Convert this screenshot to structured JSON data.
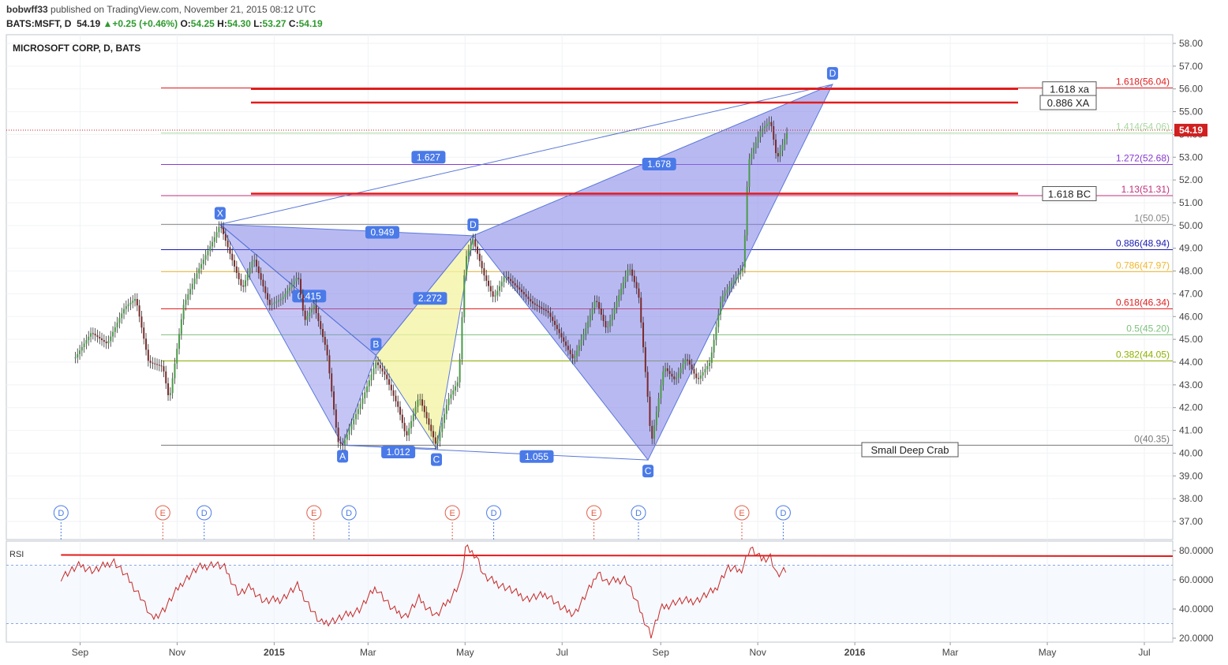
{
  "header": {
    "author": "bobwff33",
    "published": "published on TradingView.com, November 21, 2015 08:12 UTC",
    "symbol": "BATS:MSFT, D",
    "last": "54.19",
    "change": "+0.25 (+0.46%)",
    "open_label": "O:",
    "open": "54.25",
    "high_label": "H:",
    "high": "54.30",
    "low_label": "L:",
    "low": "53.27",
    "close_label": "C:",
    "close": "54.19"
  },
  "chart_data": {
    "type": "candlestick",
    "title": "MICROSOFT CORP, D, BATS",
    "price_axis": {
      "ticks": [
        "58.00",
        "57.00",
        "56.00",
        "55.00",
        "54.00",
        "53.00",
        "52.00",
        "51.00",
        "50.00",
        "49.00",
        "48.00",
        "47.00",
        "46.00",
        "45.00",
        "44.00",
        "43.00",
        "42.00",
        "41.00",
        "40.00",
        "39.00",
        "38.00",
        "37.00"
      ],
      "range": [
        36.4,
        58.5
      ]
    },
    "last_price_label": "54.19",
    "time_axis": [
      "Sep",
      "Nov",
      "2015",
      "Mar",
      "May",
      "Jul",
      "Sep",
      "Nov",
      "2016",
      "Mar",
      "May",
      "Jul"
    ],
    "price_path": [
      [
        "2014-08-29",
        44.2
      ],
      [
        "2014-09-08",
        45.3
      ],
      [
        "2014-09-18",
        44.8
      ],
      [
        "2014-09-29",
        46.4
      ],
      [
        "2014-10-06",
        46.8
      ],
      [
        "2014-10-14",
        44.0
      ],
      [
        "2014-10-23",
        43.8
      ],
      [
        "2014-10-27",
        42.3
      ],
      [
        "2014-11-05",
        46.5
      ],
      [
        "2014-11-14",
        48.0
      ],
      [
        "2014-11-24",
        49.4
      ],
      [
        "2014-11-28",
        50.05
      ],
      [
        "2014-12-05",
        48.6
      ],
      [
        "2014-12-12",
        47.2
      ],
      [
        "2014-12-19",
        48.6
      ],
      [
        "2014-12-29",
        46.5
      ],
      [
        "2015-01-06",
        46.8
      ],
      [
        "2015-01-16",
        47.8
      ],
      [
        "2015-01-20",
        45.8
      ],
      [
        "2015-01-26",
        46.5
      ],
      [
        "2015-02-03",
        44.5
      ],
      [
        "2015-02-10",
        40.5
      ],
      [
        "2015-02-13",
        40.35
      ],
      [
        "2015-02-25",
        42.3
      ],
      [
        "2015-03-06",
        44.0
      ],
      [
        "2015-03-12",
        43.4
      ],
      [
        "2015-03-20",
        42.0
      ],
      [
        "2015-03-25",
        40.7
      ],
      [
        "2015-04-02",
        42.5
      ],
      [
        "2015-04-07",
        41.5
      ],
      [
        "2015-04-13",
        40.3
      ],
      [
        "2015-04-20",
        42.3
      ],
      [
        "2015-04-27",
        43.2
      ],
      [
        "2015-05-01",
        48.5
      ],
      [
        "2015-05-06",
        49.4
      ],
      [
        "2015-05-13",
        47.8
      ],
      [
        "2015-05-19",
        46.8
      ],
      [
        "2015-05-26",
        47.8
      ],
      [
        "2015-06-04",
        47.2
      ],
      [
        "2015-06-12",
        46.6
      ],
      [
        "2015-06-22",
        46.2
      ],
      [
        "2015-06-29",
        45.3
      ],
      [
        "2015-07-08",
        44.1
      ],
      [
        "2015-07-15",
        45.3
      ],
      [
        "2015-07-22",
        46.8
      ],
      [
        "2015-07-29",
        45.4
      ],
      [
        "2015-08-05",
        46.8
      ],
      [
        "2015-08-12",
        48.2
      ],
      [
        "2015-08-18",
        47.0
      ],
      [
        "2015-08-24",
        42.3
      ],
      [
        "2015-08-26",
        40.4
      ],
      [
        "2015-09-03",
        43.8
      ],
      [
        "2015-09-10",
        43.2
      ],
      [
        "2015-09-17",
        44.2
      ],
      [
        "2015-09-24",
        43.2
      ],
      [
        "2015-10-02",
        44.0
      ],
      [
        "2015-10-09",
        46.8
      ],
      [
        "2015-10-16",
        47.5
      ],
      [
        "2015-10-23",
        48.2
      ],
      [
        "2015-10-26",
        52.8
      ],
      [
        "2015-11-03",
        54.2
      ],
      [
        "2015-11-09",
        54.6
      ],
      [
        "2015-11-13",
        52.9
      ],
      [
        "2015-11-20",
        54.19
      ]
    ],
    "fibonacci": [
      {
        "label": "0(40.35)",
        "value": 40.35,
        "color": "#777777"
      },
      {
        "label": "0.382(44.05)",
        "value": 44.05,
        "color": "#8fb000"
      },
      {
        "label": "0.5(45.20)",
        "value": 45.2,
        "color": "#7dc07d"
      },
      {
        "label": "0.618(46.34)",
        "value": 46.34,
        "color": "#e02020"
      },
      {
        "label": "0.786(47.97)",
        "value": 47.97,
        "color": "#f0b830"
      },
      {
        "label": "0.886(48.94)",
        "value": 48.94,
        "color": "#1a1ab0"
      },
      {
        "label": "1(50.05)",
        "value": 50.05,
        "color": "#888888"
      },
      {
        "label": "1.13(51.31)",
        "value": 51.31,
        "color": "#c0307a"
      },
      {
        "label": "1.272(52.68)",
        "value": 52.68,
        "color": "#8a3ad0"
      },
      {
        "label": "1.414(54.06)",
        "value": 54.06,
        "color": "#a8d8a0"
      },
      {
        "label": "1.618(56.04)",
        "value": 56.04,
        "color": "#e02020"
      }
    ],
    "targets": [
      {
        "label": "1.618 xa",
        "value": 56.0
      },
      {
        "label": "0.886 XA",
        "value": 55.4
      },
      {
        "label": "1.618 BC",
        "value": 51.4
      }
    ],
    "pattern_name": "Small Deep Crab",
    "pattern1": {
      "X": [
        "2014-11-28",
        50.05
      ],
      "A": [
        "2015-02-13",
        40.35
      ],
      "B": [
        "2015-03-06",
        44.3
      ],
      "C": [
        "2015-04-13",
        40.2
      ],
      "D": [
        "2015-05-06",
        49.55
      ],
      "labels": [
        "X",
        "A",
        "B",
        "C",
        "D"
      ],
      "ratios": [
        {
          "label": "0.949",
          "at": [
            "2015-03-10",
            49.7
          ]
        },
        {
          "label": "0.415",
          "at": [
            "2015-01-23",
            46.9
          ]
        },
        {
          "label": "2.272",
          "at": [
            "2015-04-09",
            46.8
          ]
        },
        {
          "label": "1.012",
          "at": [
            "2015-03-20",
            40.05
          ]
        },
        {
          "label": "1.627",
          "at": [
            "2015-04-08",
            53.0
          ]
        }
      ]
    },
    "pattern2": {
      "X": [
        "2015-05-06",
        49.55
      ],
      "A": [
        "2015-08-24",
        39.7
      ],
      "C": [
        "2015-08-24",
        39.7
      ],
      "D": [
        "2015-12-18",
        56.2
      ],
      "labels": [
        "C",
        "D"
      ],
      "ratios": [
        {
          "label": "1.678",
          "at": [
            "2015-08-31",
            52.7
          ]
        },
        {
          "label": "1.055",
          "at": [
            "2015-06-15",
            39.85
          ]
        }
      ]
    },
    "events": [
      {
        "type": "D",
        "date": "2014-08-20"
      },
      {
        "type": "E",
        "date": "2014-10-23"
      },
      {
        "type": "D",
        "date": "2014-11-18"
      },
      {
        "type": "E",
        "date": "2015-01-26"
      },
      {
        "type": "D",
        "date": "2015-02-17"
      },
      {
        "type": "E",
        "date": "2015-04-23"
      },
      {
        "type": "D",
        "date": "2015-05-19"
      },
      {
        "type": "E",
        "date": "2015-07-21"
      },
      {
        "type": "D",
        "date": "2015-08-18"
      },
      {
        "type": "E",
        "date": "2015-10-22"
      },
      {
        "type": "D",
        "date": "2015-11-17"
      }
    ],
    "rsi": {
      "label": "RSI",
      "ticks": [
        "80.0000",
        "60.0000",
        "40.0000",
        "20.0000"
      ],
      "range": [
        16,
        88
      ],
      "upper_band": 70,
      "lower_band": 30,
      "trendline": [
        [
          "2014-08-20",
          77.0
        ],
        [
          "2016-07-30",
          76.2
        ]
      ],
      "path": [
        [
          "2014-08-20",
          62
        ],
        [
          "2014-09-01",
          70
        ],
        [
          "2014-09-10",
          66
        ],
        [
          "2014-09-22",
          73
        ],
        [
          "2014-10-01",
          61
        ],
        [
          "2014-10-10",
          47
        ],
        [
          "2014-10-16",
          33
        ],
        [
          "2014-10-24",
          40
        ],
        [
          "2014-11-04",
          58
        ],
        [
          "2014-11-14",
          68
        ],
        [
          "2014-11-24",
          71
        ],
        [
          "2014-12-01",
          68
        ],
        [
          "2014-12-10",
          50
        ],
        [
          "2014-12-17",
          55
        ],
        [
          "2014-12-26",
          45
        ],
        [
          "2015-01-06",
          47
        ],
        [
          "2015-01-16",
          56
        ],
        [
          "2015-01-21",
          46
        ],
        [
          "2015-01-30",
          30
        ],
        [
          "2015-02-10",
          33
        ],
        [
          "2015-02-24",
          40
        ],
        [
          "2015-03-06",
          55
        ],
        [
          "2015-03-16",
          40
        ],
        [
          "2015-03-25",
          35
        ],
        [
          "2015-04-02",
          47
        ],
        [
          "2015-04-13",
          35
        ],
        [
          "2015-04-22",
          48
        ],
        [
          "2015-04-29",
          60
        ],
        [
          "2015-05-01",
          82
        ],
        [
          "2015-05-08",
          77
        ],
        [
          "2015-05-13",
          62
        ],
        [
          "2015-05-28",
          54
        ],
        [
          "2015-06-09",
          47
        ],
        [
          "2015-06-22",
          50
        ],
        [
          "2015-07-01",
          40
        ],
        [
          "2015-07-09",
          37
        ],
        [
          "2015-07-20",
          57
        ],
        [
          "2015-07-23",
          66
        ],
        [
          "2015-07-29",
          58
        ],
        [
          "2015-08-10",
          61
        ],
        [
          "2015-08-19",
          39
        ],
        [
          "2015-08-26",
          22
        ],
        [
          "2015-09-01",
          40
        ],
        [
          "2015-09-10",
          45
        ],
        [
          "2015-09-24",
          46
        ],
        [
          "2015-10-05",
          53
        ],
        [
          "2015-10-13",
          68
        ],
        [
          "2015-10-21",
          66
        ],
        [
          "2015-10-23",
          70
        ],
        [
          "2015-10-27",
          82
        ],
        [
          "2015-11-03",
          74
        ],
        [
          "2015-11-09",
          76
        ],
        [
          "2015-11-13",
          63
        ],
        [
          "2015-11-20",
          67
        ]
      ]
    },
    "grid": true
  }
}
